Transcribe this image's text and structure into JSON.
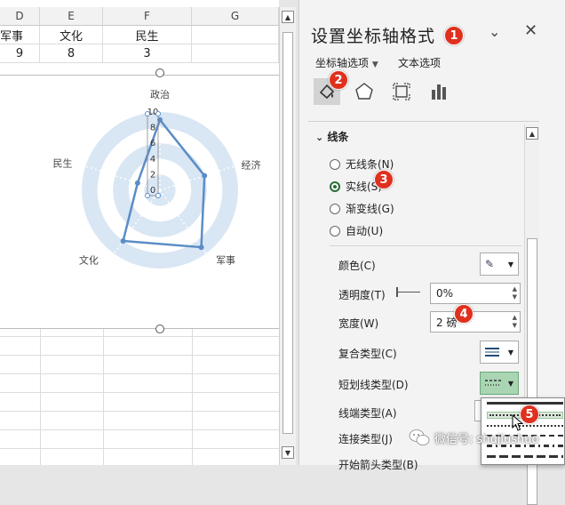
{
  "sheet": {
    "columns": [
      "D",
      "E",
      "F",
      "G"
    ],
    "header_row": [
      "军事",
      "文化",
      "民生",
      ""
    ],
    "value_row": [
      "9",
      "8",
      "3",
      ""
    ]
  },
  "chart_data": {
    "type": "radar",
    "categories": [
      "政治",
      "经济",
      "军事",
      "文化",
      "民生"
    ],
    "series": [
      {
        "values": [
          9,
          6,
          9,
          8,
          3
        ]
      }
    ],
    "r_ticks": [
      "0",
      "2",
      "4",
      "6",
      "8",
      "10"
    ],
    "rlim": [
      0,
      10
    ],
    "line_color": "#5b8dc6",
    "band_color": "#d9e6f4"
  },
  "panel": {
    "title": "设置坐标轴格式",
    "tabs": {
      "axis_options": "坐标轴选项",
      "text_options": "文本选项"
    },
    "section_title": "线条",
    "line_options": [
      {
        "label": "无线条(N)",
        "selected": false
      },
      {
        "label": "实线(S)",
        "selected": true
      },
      {
        "label": "渐变线(G)",
        "selected": false
      },
      {
        "label": "自动(U)",
        "selected": false
      }
    ],
    "props": {
      "color": "颜色(C)",
      "transparency": "透明度(T)",
      "transparency_value": "0%",
      "width": "宽度(W)",
      "width_value": "2 磅",
      "compound": "复合类型(C)",
      "dash": "短划线类型(D)",
      "cap": "线端类型(A)",
      "join": "连接类型(J)",
      "begin_arrow": "开始箭头类型(B)"
    },
    "accent_color": "#a9d5b3"
  },
  "badges": [
    "1",
    "2",
    "3",
    "4",
    "5"
  ],
  "watermark": "微信号: shujiushuo"
}
